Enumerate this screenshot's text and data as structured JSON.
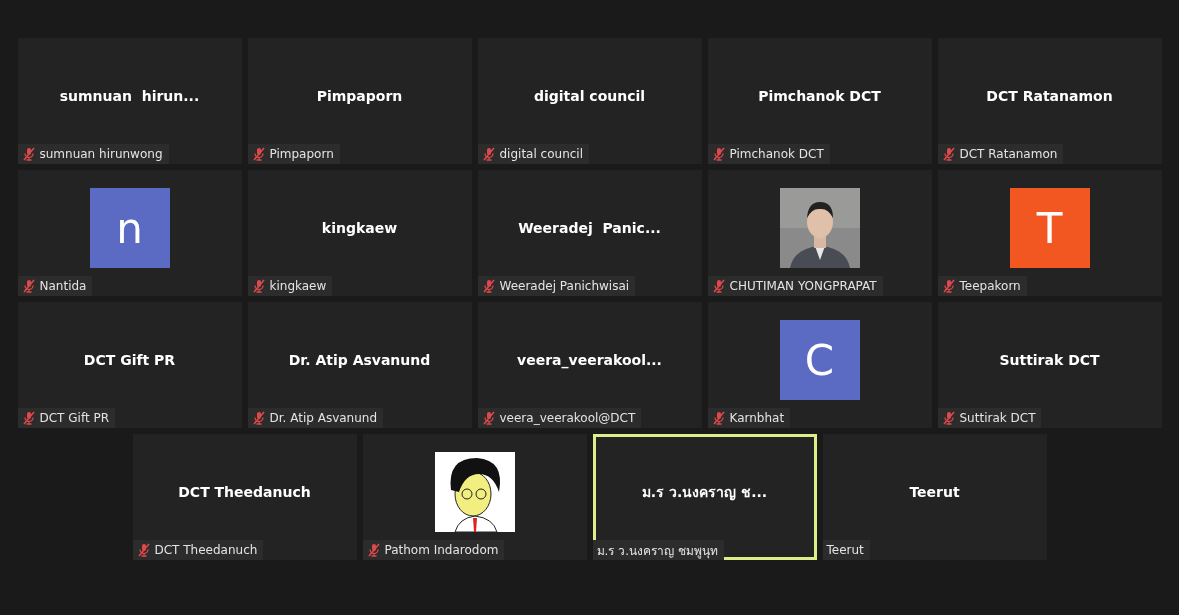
{
  "rows": [
    [
      {
        "kind": "name",
        "title": "sumnuan  hirun...",
        "label": "sumnuan hirunwong",
        "muted": true,
        "active": false
      },
      {
        "kind": "name",
        "title": "Pimpaporn",
        "label": "Pimpaporn",
        "muted": true,
        "active": false
      },
      {
        "kind": "name",
        "title": "digital council",
        "label": "digital council",
        "muted": true,
        "active": false
      },
      {
        "kind": "name",
        "title": "Pimchanok DCT",
        "label": "Pimchanok DCT",
        "muted": true,
        "active": false
      },
      {
        "kind": "name",
        "title": "DCT Ratanamon",
        "label": "DCT Ratanamon",
        "muted": true,
        "active": false
      }
    ],
    [
      {
        "kind": "avatar",
        "initial": "n",
        "color": "#5b6bc4",
        "label": "Nantida",
        "muted": true,
        "active": false
      },
      {
        "kind": "name",
        "title": "kingkaew",
        "label": "kingkaew",
        "muted": true,
        "active": false
      },
      {
        "kind": "name",
        "title": "Weeradej  Panic...",
        "label": "Weeradej Panichwisai",
        "muted": true,
        "active": false
      },
      {
        "kind": "picture",
        "label": "CHUTIMAN YONGPRAPAT",
        "muted": true,
        "active": false
      },
      {
        "kind": "avatar",
        "initial": "T",
        "color": "#f25722",
        "label": "Teepakorn",
        "muted": true,
        "active": false
      }
    ],
    [
      {
        "kind": "name",
        "title": "DCT Gift PR",
        "label": "DCT Gift PR",
        "muted": true,
        "active": false
      },
      {
        "kind": "name",
        "title": "Dr. Atip Asvanund",
        "label": "Dr. Atip Asvanund",
        "muted": true,
        "active": false
      },
      {
        "kind": "name",
        "title": "veera_veerakool...",
        "label": "veera_veerakool@DCT",
        "muted": true,
        "active": false
      },
      {
        "kind": "avatar",
        "initial": "C",
        "color": "#5b6bc4",
        "label": "Karnbhat",
        "muted": true,
        "active": false
      },
      {
        "kind": "name",
        "title": "Suttirak DCT",
        "label": "Suttirak DCT",
        "muted": true,
        "active": false
      }
    ],
    [
      {
        "kind": "name",
        "title": "DCT Theedanuch",
        "label": "DCT Theedanuch",
        "muted": true,
        "active": false
      },
      {
        "kind": "cartoon",
        "label": "Pathom Indarodom",
        "muted": true,
        "active": false
      },
      {
        "kind": "name",
        "title": "ม.ร ว.นงคราญ ช...",
        "label": "ม.ร ว.นงคราญ ชมพูนุท",
        "muted": false,
        "active": true
      },
      {
        "kind": "name",
        "title": "Teerut",
        "label": "Teerut",
        "muted": false,
        "active": false
      }
    ]
  ]
}
